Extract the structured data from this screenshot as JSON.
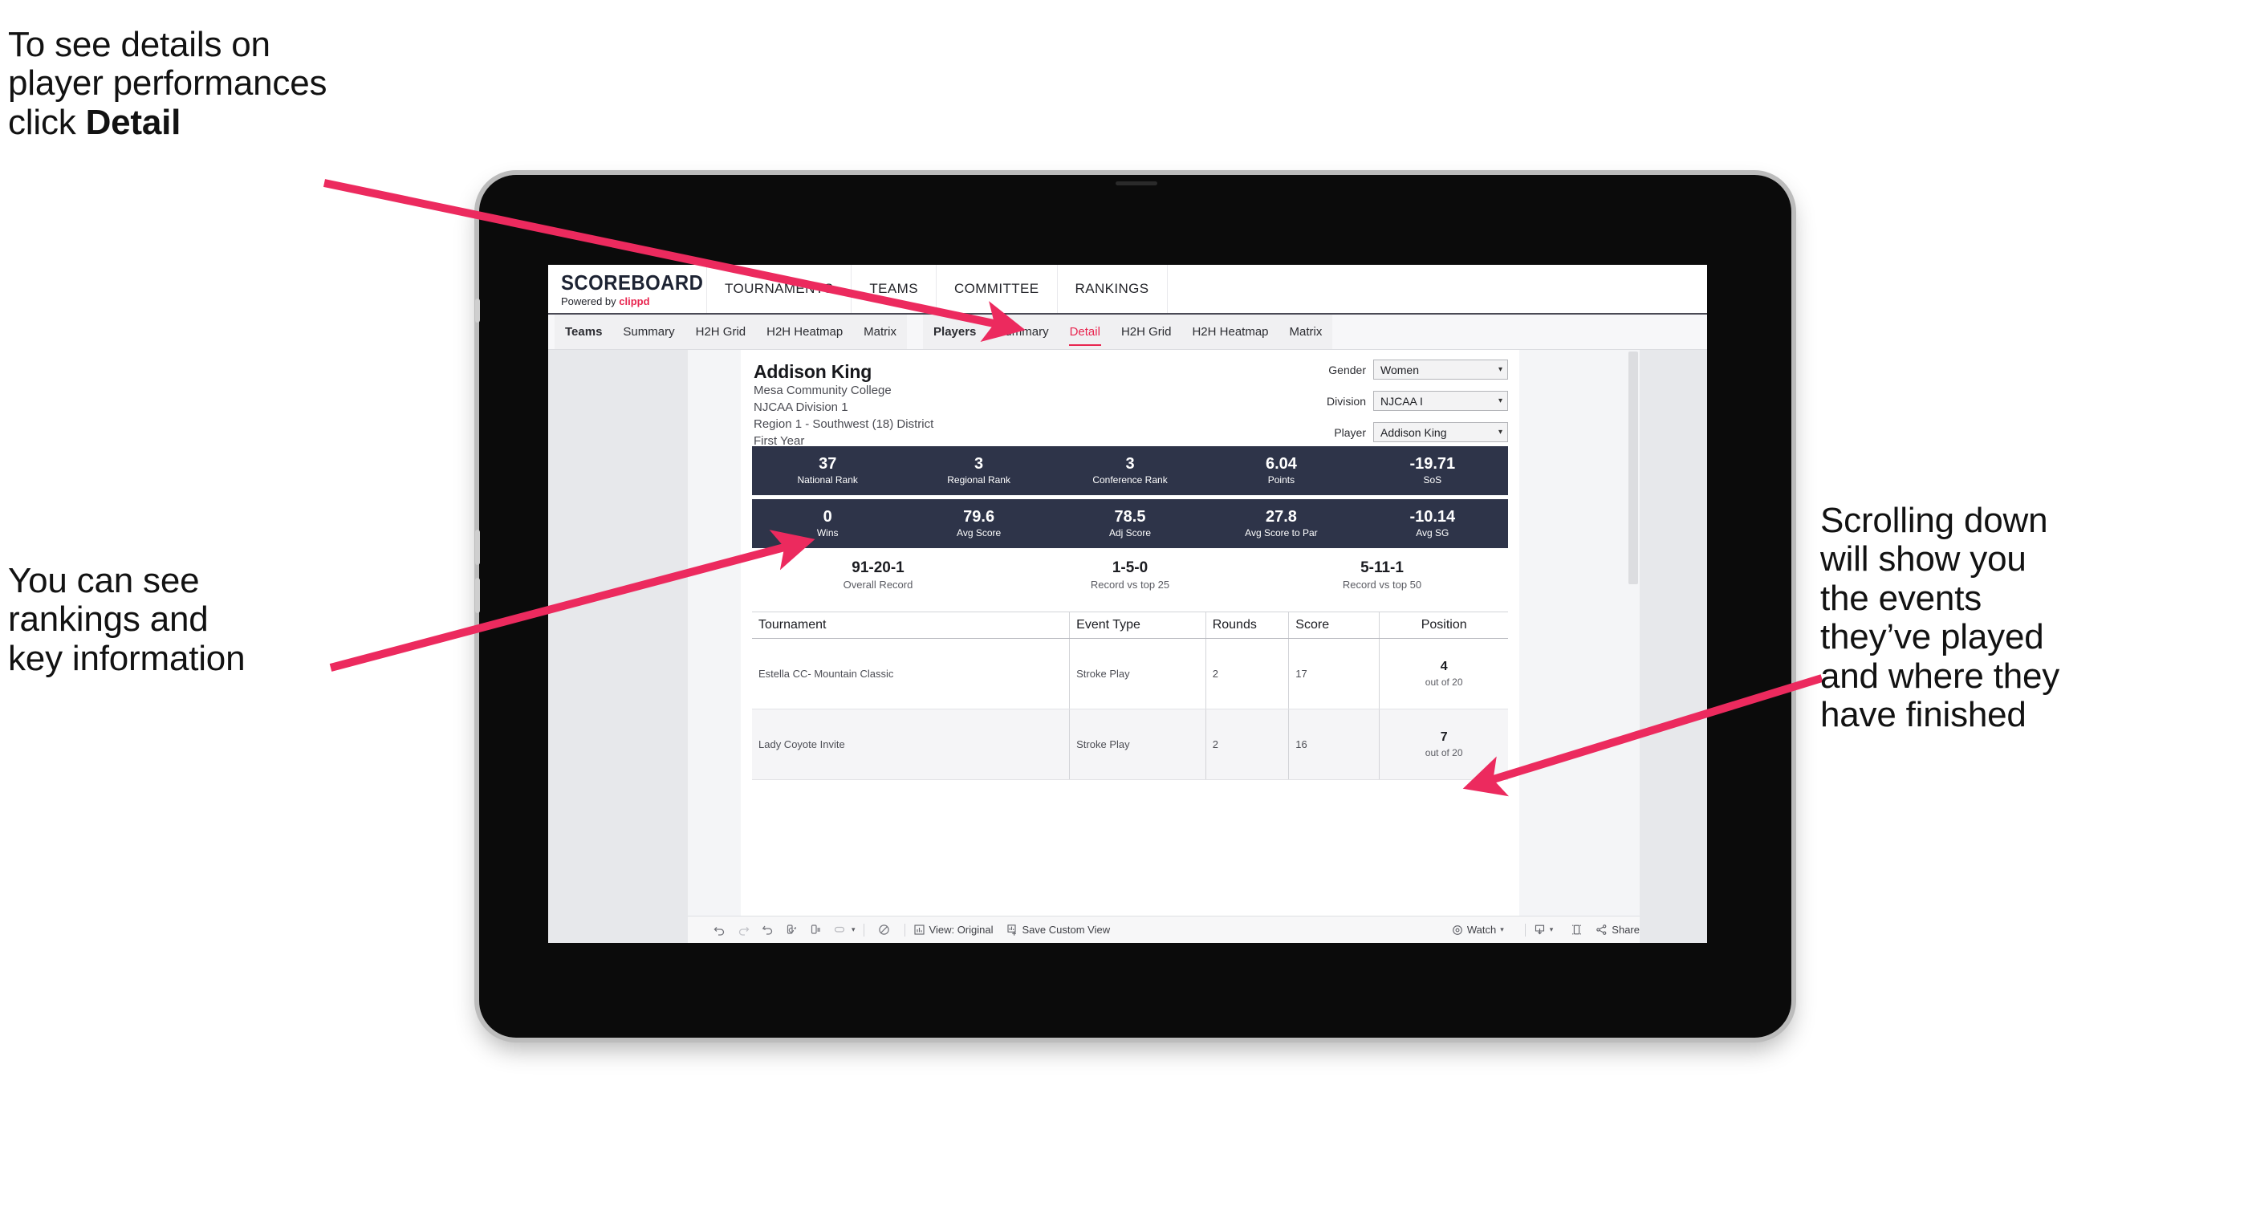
{
  "annotations": {
    "top_left": "To see details on\nplayer performances\nclick ",
    "top_left_bold": "Detail",
    "mid_left": "You can see\nrankings and\nkey information",
    "right": "Scrolling down\nwill show you\nthe events\nthey’ve played\nand where they\nhave finished",
    "arrow_color": "#ec2a5e"
  },
  "app": {
    "brand": {
      "title": "SCOREBOARD",
      "powered_prefix": "Powered by ",
      "powered_brand": "clippd"
    },
    "top_nav": [
      "TOURNAMENTS",
      "TEAMS",
      "COMMITTEE",
      "RANKINGS"
    ],
    "tabs_teams": [
      "Teams",
      "Summary",
      "H2H Grid",
      "H2H Heatmap",
      "Matrix"
    ],
    "tabs_players": [
      "Players",
      "Summary",
      "Detail",
      "H2H Grid",
      "H2H Heatmap",
      "Matrix"
    ],
    "active_tab": "Detail",
    "accent": "#e8254f",
    "stat_bar_bg": "#2e3449"
  },
  "player": {
    "name": "Addison King",
    "school": "Mesa Community College",
    "division": "NJCAA Division 1",
    "region": "Region 1 - Southwest (18) District",
    "year": "First Year"
  },
  "filters": [
    {
      "label": "Gender",
      "value": "Women"
    },
    {
      "label": "Division",
      "value": "NJCAA I"
    },
    {
      "label": "Player",
      "value": "Addison King"
    }
  ],
  "stats_row1": [
    {
      "value": "37",
      "label": "National Rank"
    },
    {
      "value": "3",
      "label": "Regional Rank"
    },
    {
      "value": "3",
      "label": "Conference Rank"
    },
    {
      "value": "6.04",
      "label": "Points"
    },
    {
      "value": "-19.71",
      "label": "SoS"
    }
  ],
  "stats_row2": [
    {
      "value": "0",
      "label": "Wins"
    },
    {
      "value": "79.6",
      "label": "Avg Score"
    },
    {
      "value": "78.5",
      "label": "Adj Score"
    },
    {
      "value": "27.8",
      "label": "Avg Score to Par"
    },
    {
      "value": "-10.14",
      "label": "Avg SG"
    }
  ],
  "records": [
    {
      "value": "91-20-1",
      "label": "Overall Record"
    },
    {
      "value": "1-5-0",
      "label": "Record vs top 25"
    },
    {
      "value": "5-11-1",
      "label": "Record vs top 50"
    }
  ],
  "table": {
    "headers": [
      "Tournament",
      "Event Type",
      "Rounds",
      "Score",
      "Position"
    ],
    "rows": [
      {
        "tournament": "Estella CC- Mountain Classic",
        "event_type": "Stroke Play",
        "rounds": "2",
        "score": "17",
        "position": "4",
        "position_sub": "out of 20"
      },
      {
        "tournament": "Lady Coyote Invite",
        "event_type": "Stroke Play",
        "rounds": "2",
        "score": "16",
        "position": "7",
        "position_sub": "out of 20"
      }
    ]
  },
  "toolbar": {
    "icons": [
      "undo-icon",
      "redo-icon",
      "revert-icon",
      "refresh-icon",
      "pause-icon",
      "device-layout-icon"
    ],
    "view_label": "View: Original",
    "save_label": "Save Custom View",
    "watch_label": "Watch",
    "share_label": "Share"
  }
}
